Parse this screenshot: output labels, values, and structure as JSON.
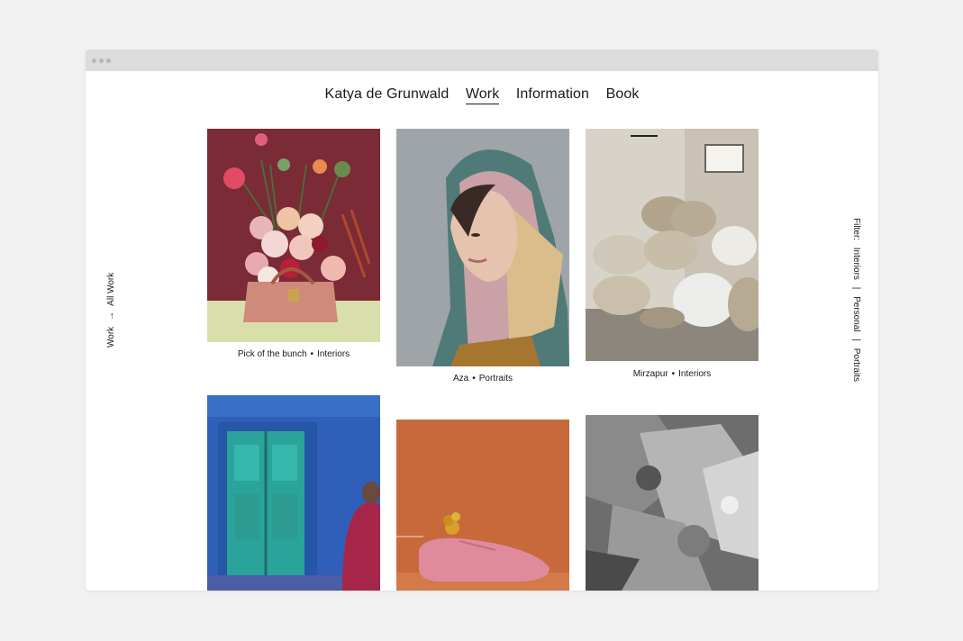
{
  "nav": {
    "items": [
      "Katya de Grunwald",
      "Work",
      "Information",
      "Book"
    ],
    "active": "Work"
  },
  "breadcrumb": {
    "section": "Work",
    "arrow": "→",
    "current": "All Work"
  },
  "filters": {
    "label": "Filter:",
    "options": [
      "Interiors",
      "Personal",
      "Portraits"
    ],
    "separator": "|"
  },
  "gallery": [
    {
      "title": "Pick of the bunch",
      "category": "Interiors",
      "bullet": "•"
    },
    {
      "title": "Aza",
      "category": "Portraits",
      "bullet": "•"
    },
    {
      "title": "Mirzapur",
      "category": "Interiors",
      "bullet": "•"
    },
    {
      "title": "",
      "category": ""
    },
    {
      "title": "",
      "category": ""
    },
    {
      "title": "",
      "category": ""
    }
  ],
  "colors": {
    "window_bg": "#ffffff",
    "page_bg": "#f1f1f1",
    "titlebar": "#dcdcdc",
    "text": "#1a1a1a"
  }
}
